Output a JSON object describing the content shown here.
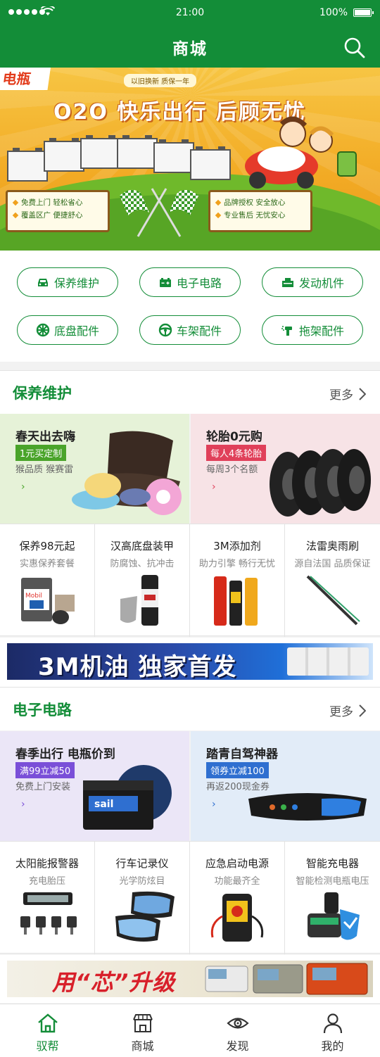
{
  "status": {
    "time": "21:00",
    "battery": "100%"
  },
  "header": {
    "title": "商城"
  },
  "banner": {
    "corner": "电瓶",
    "tag": "以旧换新 质保一年",
    "headline": "O2O 快乐出行  后顾无忧",
    "left_sign": [
      "免费上门  轻松省心",
      "覆盖区广  便捷舒心"
    ],
    "right_sign": [
      "品牌授权  安全放心",
      "专业售后  无忧安心"
    ]
  },
  "categories": [
    {
      "label": "保养维护",
      "icon": "car-icon"
    },
    {
      "label": "电子电路",
      "icon": "battery-icon"
    },
    {
      "label": "发动机件",
      "icon": "engine-icon"
    },
    {
      "label": "底盘配件",
      "icon": "wheel-icon"
    },
    {
      "label": "车架配件",
      "icon": "steering-wheel-icon"
    },
    {
      "label": "拖架配件",
      "icon": "spray-gun-icon"
    }
  ],
  "section1": {
    "title": "保养维护",
    "more": "更多",
    "promos": [
      {
        "title": "春天出去嗨",
        "badge": "1元买定制",
        "sub": "猴品质 猴赛雷",
        "badge_color": "#4aa42a",
        "bg": "#e6f2d8"
      },
      {
        "title": "轮胎0元购",
        "badge": "每人4条轮胎",
        "sub": "每周3个名额",
        "badge_color": "#e0405a",
        "bg": "#f7e3e6"
      }
    ],
    "products": [
      {
        "title": "保养98元起",
        "sub": "实惠保养套餐"
      },
      {
        "title": "汉高底盘装甲",
        "sub": "防腐蚀、抗冲击"
      },
      {
        "title": "3M添加剂",
        "sub": "助力引擎 畅行无忧"
      },
      {
        "title": "法雷奥雨刷",
        "sub": "源自法国 品质保证"
      }
    ],
    "ad": "3M机油 独家首发"
  },
  "section2": {
    "title": "电子电路",
    "more": "更多",
    "promos": [
      {
        "title": "春季出行 电瓶价到",
        "badge": "满99立减50",
        "sub": "免费上门安装",
        "badge_color": "#7a4fd8",
        "bg": "#ebe6f7"
      },
      {
        "title": "踏青自驾神器",
        "badge": "领券立减100",
        "sub": "再返200现金券",
        "badge_color": "#2f6fd0",
        "bg": "#e2ecf8"
      }
    ],
    "products": [
      {
        "title": "太阳能报警器",
        "sub": "充电胎压"
      },
      {
        "title": "行车记录仪",
        "sub": "光学防炫目"
      },
      {
        "title": "应急启动电源",
        "sub": "功能最齐全"
      },
      {
        "title": "智能充电器",
        "sub": "智能检测电瓶电压"
      }
    ],
    "ad": "用“芯”升级"
  },
  "product_texts": {
    "battery_brand": "sail",
    "oil_brand": "Mobil"
  },
  "tabs": [
    {
      "label": "驭帮",
      "icon": "home-icon",
      "active": true
    },
    {
      "label": "商城",
      "icon": "store-icon",
      "active": false
    },
    {
      "label": "发现",
      "icon": "eye-icon",
      "active": false
    },
    {
      "label": "我的",
      "icon": "user-icon",
      "active": false
    }
  ],
  "colors": {
    "brand": "#138d38",
    "banner_bg": "#f3b12a"
  }
}
